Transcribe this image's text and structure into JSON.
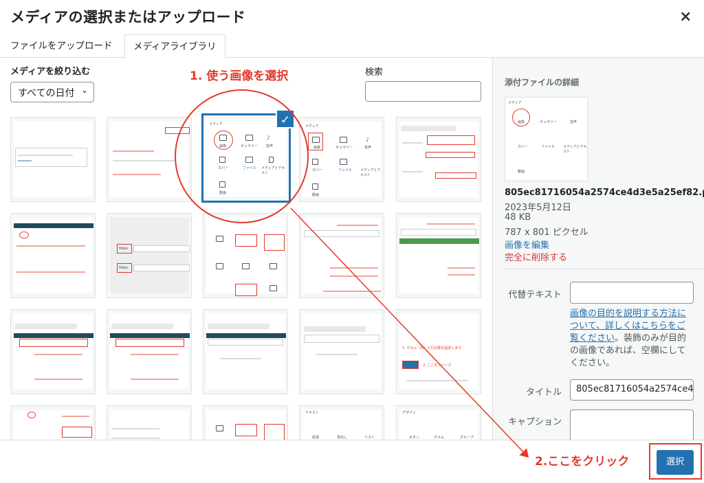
{
  "modal": {
    "title": "メディアの選択またはアップロード",
    "close_icon": "×"
  },
  "tabs": [
    {
      "label": "ファイルをアップロード"
    },
    {
      "label": "メディアライブラリ"
    }
  ],
  "toolbar": {
    "filter_label": "メディアを絞り込む",
    "date_filter_value": "すべての日付",
    "search_label": "検索",
    "search_value": ""
  },
  "annotations": {
    "step1": "1. 使う画像を選択",
    "step2": "2.ここをクリック",
    "color": "#e3392a"
  },
  "tile_thumb_labels": {
    "image": "画像",
    "gallery": "ギャラリー",
    "audio": "音声",
    "cover": "カバー",
    "file": "ファイル",
    "media_text": "メディアとテキスト",
    "video": "動画",
    "text_head": "メディア",
    "text_head2": "テキスト",
    "design_head": "デザイン",
    "paragraph": "段落",
    "heading": "見出し",
    "list": "リスト",
    "button": "ボタン",
    "columns": "カラム",
    "group": "グループ",
    "http": "https",
    "column_step": "1. カラム（列）と行の数を設定します",
    "click_here": "2. ここをクリック"
  },
  "details": {
    "heading": "添付ファイルの詳細",
    "filename": "805ec81716054a2574ce4d3e5a25ef82.png",
    "date": "2023年5月12日",
    "size": "48 KB",
    "dimensions": "787 x 801 ピクセル",
    "edit_link": "画像を編集",
    "delete_link": "完全に削除する",
    "alt_label": "代替テキスト",
    "alt_value": "",
    "alt_help_link": "画像の目的を説明する方法について、詳しくはこちらをご覧ください",
    "alt_help_suffix": "。装飾のみが目的の画像であれば、空欄にしてください。",
    "title_label": "タイトル",
    "title_value": "805ec81716054a2574ce4d3e5a25ef82",
    "caption_label": "キャプション",
    "caption_value": ""
  },
  "footer": {
    "select_button": "選択",
    "accent_color": "#2271b1"
  }
}
